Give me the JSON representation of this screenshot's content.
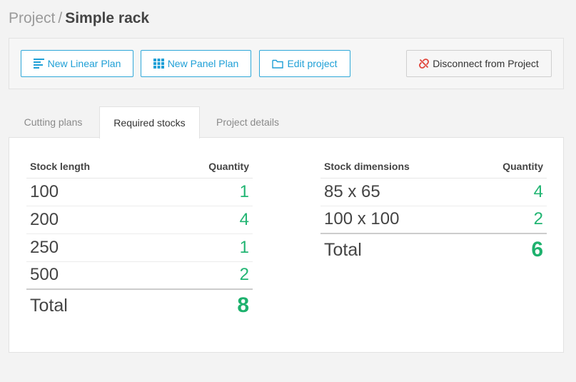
{
  "breadcrumb": {
    "parent": "Project",
    "separator": "/",
    "current": "Simple rack"
  },
  "toolbar": {
    "new_linear_plan": "New Linear Plan",
    "new_panel_plan": "New Panel Plan",
    "edit_project": "Edit project",
    "disconnect": "Disconnect from Project"
  },
  "tabs": [
    {
      "label": "Cutting plans"
    },
    {
      "label": "Required stocks"
    },
    {
      "label": "Project details"
    }
  ],
  "active_tab": "Required stocks",
  "linear_stocks": {
    "col_length": "Stock length",
    "col_quantity": "Quantity",
    "rows": [
      {
        "length": "100",
        "quantity": "1"
      },
      {
        "length": "200",
        "quantity": "4"
      },
      {
        "length": "250",
        "quantity": "1"
      },
      {
        "length": "500",
        "quantity": "2"
      }
    ],
    "total_label": "Total",
    "total_quantity": "8"
  },
  "panel_stocks": {
    "col_dimensions": "Stock dimensions",
    "col_quantity": "Quantity",
    "rows": [
      {
        "dimensions": "85 x 65",
        "quantity": "4"
      },
      {
        "dimensions": "100 x 100",
        "quantity": "2"
      }
    ],
    "total_label": "Total",
    "total_quantity": "6"
  },
  "colors": {
    "accent": "#1e9fd6",
    "quantity_green": "#22b573",
    "disconnect_icon": "#e0443a"
  }
}
